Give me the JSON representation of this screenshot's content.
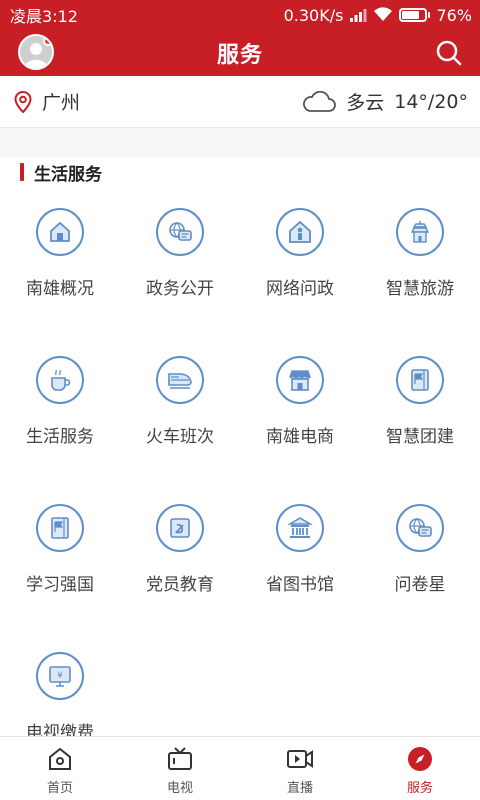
{
  "status": {
    "time": "凌晨3:12",
    "speed": "0.30K/s",
    "battery": "76%",
    "battery_level": 0.76
  },
  "header": {
    "title": "服务"
  },
  "location": {
    "city": "广州",
    "weather": "多云",
    "temperature": "14°/20°"
  },
  "section": {
    "title": "生活服务"
  },
  "services": [
    {
      "label": "南雄概况",
      "icon": "house-icon"
    },
    {
      "label": "政务公开",
      "icon": "globe-chat-icon"
    },
    {
      "label": "网络问政",
      "icon": "person-house-icon"
    },
    {
      "label": "智慧旅游",
      "icon": "pagoda-icon"
    },
    {
      "label": "生活服务",
      "icon": "coffee-cup-icon"
    },
    {
      "label": "火车班次",
      "icon": "train-icon"
    },
    {
      "label": "南雄电商",
      "icon": "shop-icon"
    },
    {
      "label": "智慧团建",
      "icon": "flag-book-icon"
    },
    {
      "label": "学习强国",
      "icon": "flag-book-icon"
    },
    {
      "label": "党员教育",
      "icon": "party-emblem-icon"
    },
    {
      "label": "省图书馆",
      "icon": "library-icon"
    },
    {
      "label": "问卷星",
      "icon": "globe-chat-icon"
    },
    {
      "label": "电视缴费",
      "icon": "tv-pay-icon"
    }
  ],
  "tabs": [
    {
      "label": "首页",
      "icon": "home-icon",
      "active": false
    },
    {
      "label": "电视",
      "icon": "tv-icon",
      "active": false
    },
    {
      "label": "直播",
      "icon": "video-icon",
      "active": false
    },
    {
      "label": "服务",
      "icon": "compass-icon",
      "active": true
    }
  ],
  "colors": {
    "brand": "#c81e26",
    "icon": "#5d8ec9",
    "icon_fill": "#dbe8f6"
  }
}
